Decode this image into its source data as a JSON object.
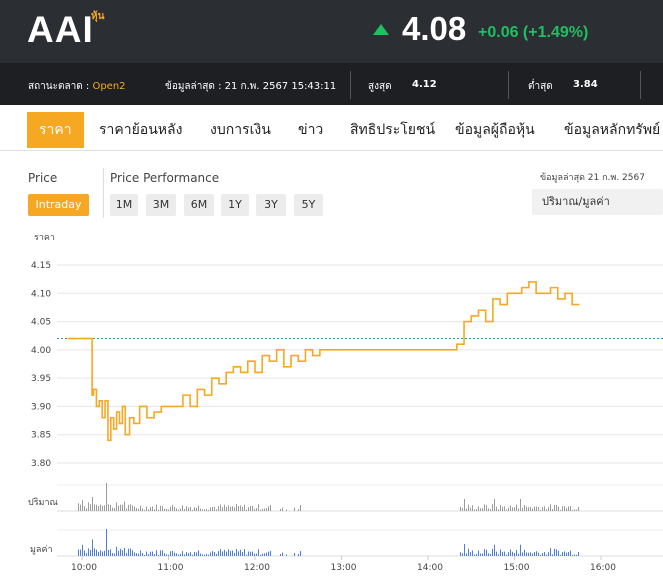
{
  "header": {
    "symbol": "AAI",
    "symbol_tag": "หุ้น",
    "price": "4.08",
    "change": "+0.06 (+1.49%)",
    "colors": {
      "up": "#1fbf62",
      "accent": "#f7a823",
      "header_bg": "#2b2e33"
    }
  },
  "infobar": {
    "status_label": "สถานะตลาด : ",
    "status_value": "Open2",
    "last_update": "ข้อมูลล่าสุด : 21 ก.พ. 2567 15:43:11",
    "high_label": "สูงสุด",
    "high_value": "4.12",
    "low_label": "ต่ำสุด",
    "low_value": "3.84"
  },
  "tabs": [
    {
      "label": "ราคา",
      "active": true
    },
    {
      "label": "ราคาย้อนหลัง"
    },
    {
      "label": "งบการเงิน"
    },
    {
      "label": "ข่าว"
    },
    {
      "label": "สิทธิประโยชน์"
    },
    {
      "label": "ข้อมูลผู้ถือหุ้น"
    },
    {
      "label": "ข้อมูลหลักทรัพย์"
    }
  ],
  "controls": {
    "price_label": "Price",
    "intraday": "Intraday",
    "performance_label": "Price Performance",
    "periods": [
      "1M",
      "3M",
      "6M",
      "1Y",
      "3Y",
      "5Y"
    ],
    "update_note": "ข้อมูลล่าสุด 21 ก.พ. 2567",
    "select_value": "ปริมาณ/มูลค่า"
  },
  "chart_data": {
    "type": "line",
    "ylabel": "ราคา",
    "ylim": [
      3.8,
      4.15
    ],
    "yticks": [
      "4.15",
      "4.10",
      "4.05",
      "4.00",
      "3.95",
      "3.90",
      "3.85",
      "3.80"
    ],
    "xticks": [
      "10:00",
      "11:00",
      "12:00",
      "13:00",
      "14:00",
      "15:00",
      "16:00"
    ],
    "reference_price": 4.02,
    "series": [
      {
        "x": [
          "09:50",
          "10:05",
          "10:07",
          "10:08",
          "10:10",
          "10:12",
          "10:14",
          "10:16",
          "10:18",
          "10:20",
          "10:22",
          "10:24",
          "10:26",
          "10:28",
          "10:30",
          "10:33",
          "10:36",
          "10:40",
          "10:45",
          "10:50",
          "10:55",
          "11:00",
          "11:10",
          "11:15",
          "11:20",
          "11:25",
          "11:30",
          "11:35",
          "11:40",
          "11:45",
          "11:50",
          "11:55",
          "12:00",
          "12:05",
          "12:10",
          "12:15",
          "12:20",
          "12:25",
          "12:30",
          "12:35",
          "12:40",
          "12:45",
          "12:50",
          "13:00",
          "13:30",
          "14:00",
          "14:20",
          "14:25",
          "14:30",
          "14:35",
          "14:40",
          "14:45",
          "14:50",
          "14:55",
          "15:00",
          "15:05",
          "15:10",
          "15:15",
          "15:20",
          "15:25",
          "15:30",
          "15:35",
          "15:40",
          "15:45"
        ],
        "values": [
          4.02,
          4.02,
          3.92,
          3.93,
          3.9,
          3.91,
          3.88,
          3.91,
          3.84,
          3.88,
          3.86,
          3.89,
          3.87,
          3.9,
          3.85,
          3.88,
          3.87,
          3.9,
          3.88,
          3.89,
          3.9,
          3.9,
          3.92,
          3.9,
          3.93,
          3.92,
          3.95,
          3.94,
          3.96,
          3.97,
          3.96,
          3.98,
          3.96,
          3.99,
          3.98,
          4.0,
          3.97,
          3.99,
          3.98,
          4.0,
          3.99,
          4.0,
          4.0,
          4.0,
          4.0,
          4.0,
          4.01,
          4.05,
          4.06,
          4.07,
          4.05,
          4.09,
          4.08,
          4.1,
          4.1,
          4.11,
          4.12,
          4.1,
          4.1,
          4.11,
          4.09,
          4.1,
          4.08,
          4.08
        ]
      }
    ],
    "volume_label": "ปริมาณ",
    "value_label": "มูลค่า"
  }
}
